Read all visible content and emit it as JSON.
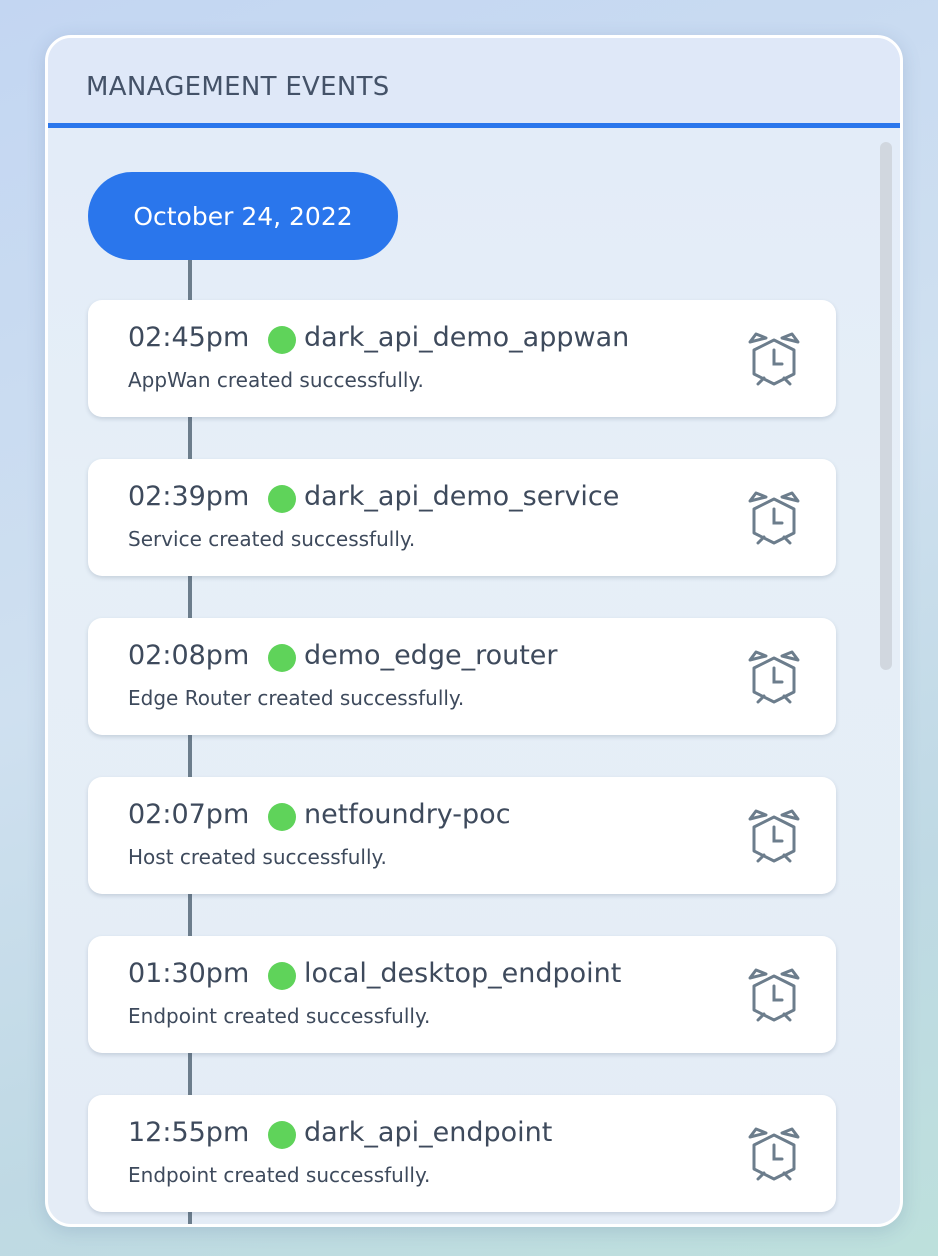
{
  "panel": {
    "title": "MANAGEMENT EVENTS"
  },
  "timeline": {
    "date": "October 24, 2022",
    "events": [
      {
        "time": "02:45pm",
        "name": "dark_api_demo_appwan",
        "description": "AppWan created successfully.",
        "status": "success",
        "icon": "alarm-clock-icon"
      },
      {
        "time": "02:39pm",
        "name": "dark_api_demo_service",
        "description": "Service created successfully.",
        "status": "success",
        "icon": "alarm-clock-icon"
      },
      {
        "time": "02:08pm",
        "name": "demo_edge_router",
        "description": "Edge Router created successfully.",
        "status": "success",
        "icon": "alarm-clock-icon"
      },
      {
        "time": "02:07pm",
        "name": "netfoundry-poc",
        "description": "Host created successfully.",
        "status": "success",
        "icon": "alarm-clock-icon"
      },
      {
        "time": "01:30pm",
        "name": "local_desktop_endpoint",
        "description": "Endpoint created successfully.",
        "status": "success",
        "icon": "alarm-clock-icon"
      },
      {
        "time": "12:55pm",
        "name": "dark_api_endpoint",
        "description": "Endpoint created successfully.",
        "status": "success",
        "icon": "alarm-clock-icon"
      }
    ]
  },
  "colors": {
    "accent": "#2a76ec",
    "success": "#5fd35a",
    "text": "#3e4a5c",
    "timeline": "#6c7d8c"
  }
}
